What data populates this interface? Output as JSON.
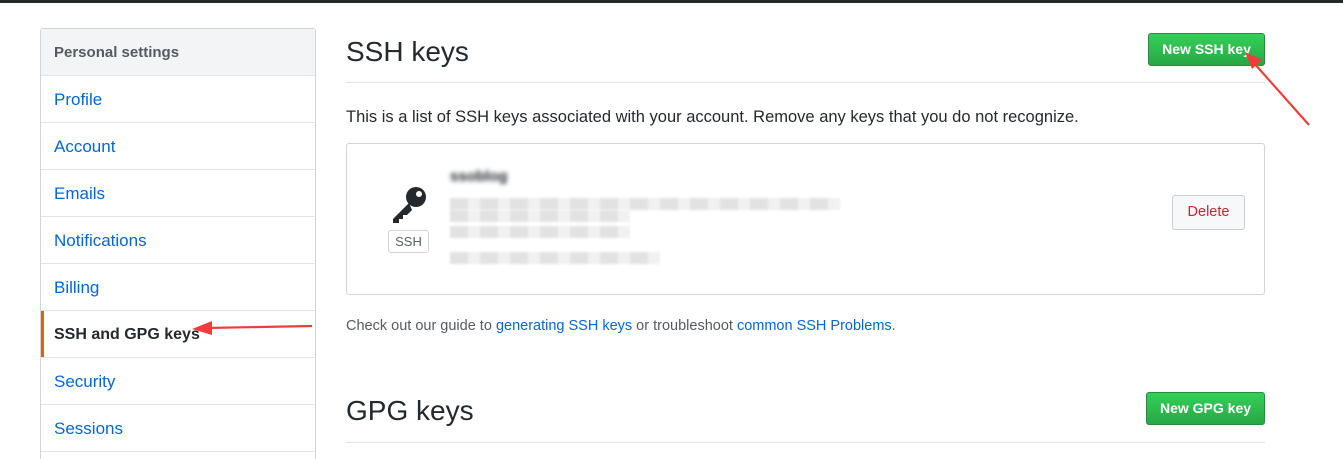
{
  "sidebar": {
    "header": "Personal settings",
    "items": [
      {
        "label": "Profile"
      },
      {
        "label": "Account"
      },
      {
        "label": "Emails"
      },
      {
        "label": "Notifications"
      },
      {
        "label": "Billing"
      },
      {
        "label": "SSH and GPG keys",
        "selected": true
      },
      {
        "label": "Security"
      },
      {
        "label": "Sessions"
      }
    ]
  },
  "ssh": {
    "title": "SSH keys",
    "new_button": "New SSH key",
    "intro": "This is a list of SSH keys associated with your account. Remove any keys that you do not recognize.",
    "key": {
      "title": "ssoblog",
      "badge": "SSH",
      "delete_label": "Delete"
    }
  },
  "guide": {
    "prefix": "Check out our guide to ",
    "link1": "generating SSH keys",
    "middle": " or troubleshoot ",
    "link2": "common SSH Problems",
    "suffix": "."
  },
  "gpg": {
    "title": "GPG keys",
    "new_button": "New GPG key"
  },
  "colors": {
    "accent_green": "#28a745",
    "link": "#0366d6",
    "selected_marker": "#e36209",
    "danger": "#cb2431",
    "annotation_arrow": "#f03c3c"
  },
  "icons": [
    "key-icon"
  ]
}
